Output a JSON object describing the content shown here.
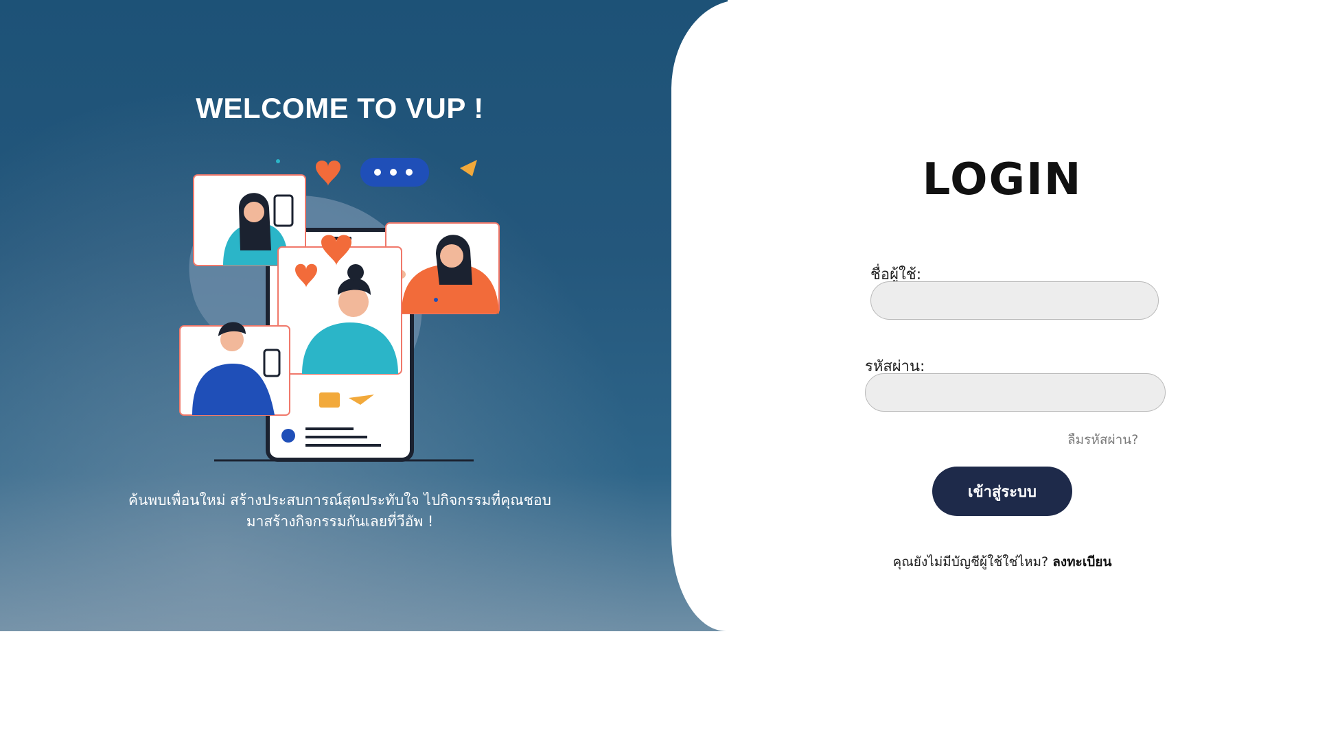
{
  "hero": {
    "title": "WELCOME TO VUP !",
    "tagline_line1": "ค้นพบเพื่อนใหม่ สร้างประสบการณ์สุดประทับใจ ไปกิจกรรมที่คุณชอบ",
    "tagline_line2": "มาสร้างกิจกรรมกันเลยที่วีอัพ !",
    "illustration_icons": [
      "heart-icon",
      "chat-bubble-icon",
      "paper-plane-icon",
      "phone-icon",
      "user-icon"
    ]
  },
  "login": {
    "title": "LOGIN",
    "username_label": "ชื่อผู้ใช้:",
    "username_value": "",
    "password_label": "รหัสผ่าน:",
    "password_value": "",
    "forgot_label": "ลืมรหัสผ่าน?",
    "submit_label": "เข้าสู่ระบบ",
    "signup_prompt": "คุณยังไม่มีบัญชีผู้ใช้ใช่ไหม?",
    "signup_link": "ลงทะเบียน"
  },
  "colors": {
    "hero_bg": "#24577c",
    "button_bg": "#1e2a4a",
    "input_bg": "#ededed",
    "accent_orange": "#f26b3a",
    "accent_teal": "#2bb5c8",
    "accent_blue": "#1f4fb8"
  }
}
